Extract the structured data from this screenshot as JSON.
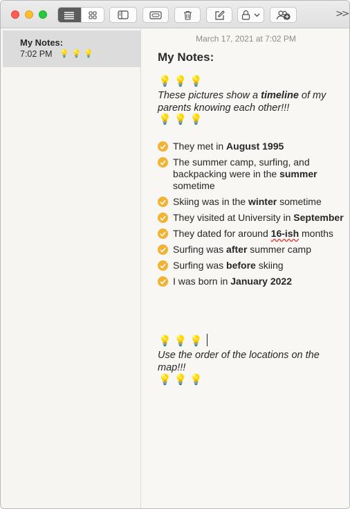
{
  "sidebar": {
    "note": {
      "title": "My Notes:",
      "time": "7:02 PM",
      "preview": "💡💡💡"
    }
  },
  "editor": {
    "date": "March 17, 2021 at 7:02 PM",
    "heading": "My Notes:",
    "bulbs": "💡💡💡",
    "intro": {
      "pre": "These pictures show a ",
      "bold": "timeline",
      "post": " of my parents knowing each other!!!"
    },
    "checklist": [
      {
        "pre": "They met in ",
        "bold": "August 1995",
        "post": ""
      },
      {
        "pre": "The summer camp, surfing, and backpacking were in the ",
        "bold": "summer",
        "post": " sometime"
      },
      {
        "pre": "Skiing was in the ",
        "bold": "winter",
        "post": " sometime"
      },
      {
        "pre": "They visited at University in ",
        "bold": "September",
        "post": ""
      },
      {
        "pre": "They dated for around ",
        "bold": "16-ish",
        "post": " months"
      },
      {
        "pre": "Surfing was ",
        "bold": "after",
        "post": " summer camp"
      },
      {
        "pre": "Surfing was ",
        "bold": "before",
        "post": " skiing"
      },
      {
        "pre": "I was born in ",
        "bold": "January 2022",
        "post": ""
      }
    ],
    "outro": "Use the order of the locations on the map!!!"
  },
  "colors": {
    "check": "#f2b233",
    "accent_dark": "#5c5c5c"
  },
  "icons": {
    "toolbar": [
      "list-view-icon",
      "gallery-view-icon",
      "sidebar-toggle-icon",
      "attachments-icon",
      "trash-icon",
      "compose-icon",
      "lock-icon",
      "add-people-icon",
      "chevron-more-icon"
    ]
  }
}
